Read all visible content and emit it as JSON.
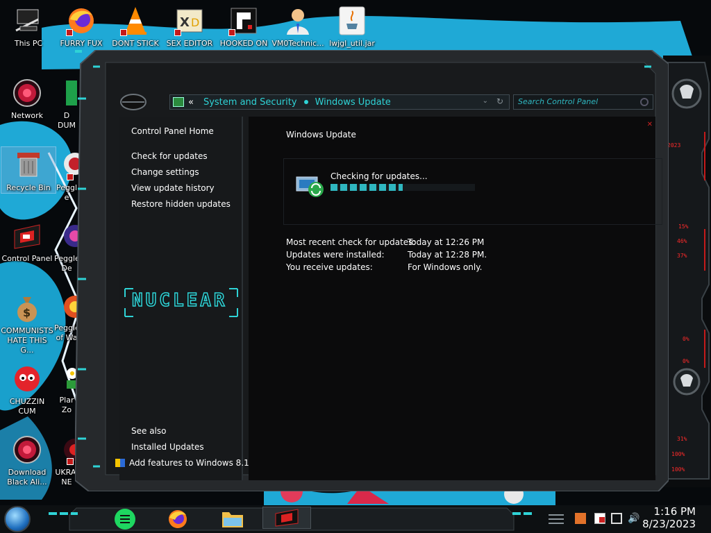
{
  "desktop_icons": [
    {
      "label": "This PC",
      "icon": "computer-icon"
    },
    {
      "label": "FURRY FUX",
      "icon": "firefox-icon"
    },
    {
      "label": "DONT STICK",
      "icon": "vlc-cone-icon"
    },
    {
      "label": "SEX EDITOR",
      "icon": "hex-editor-icon"
    },
    {
      "label": "HOOKED ON",
      "icon": "game-icon"
    },
    {
      "label": "VM0Technic...",
      "icon": "doctor-avatar-icon"
    },
    {
      "label": "lwjgl_util.jar",
      "icon": "java-icon"
    },
    {
      "label": "Network",
      "icon": "alien-orb-icon"
    },
    {
      "label": "D\nDUM",
      "icon": "partial-icon"
    },
    {
      "label": "Recycle Bin",
      "icon": "recycle-bin-icon"
    },
    {
      "label": "Peggle",
      "icon": "peggle-icon"
    },
    {
      "label": "Control Panel",
      "icon": "control-panel-icon"
    },
    {
      "label": "Peggle\nDe",
      "icon": "peggle-icon"
    },
    {
      "label": "COMMUNISTS HATE THIS G...",
      "icon": "money-bag-icon"
    },
    {
      "label": "Peggle\nof Wa",
      "icon": "peggle-icon"
    },
    {
      "label": "CHUZZIN CUM",
      "icon": "chuzzle-icon"
    },
    {
      "label": "Plar\nZo",
      "icon": "plants-icon"
    },
    {
      "label": "Download Black Ali...",
      "icon": "alien-orb-icon"
    },
    {
      "label": "UKRAINE",
      "icon": "ukraine-icon"
    }
  ],
  "window": {
    "breadcrumb": {
      "back_glyph": "«",
      "items": [
        "System and Security",
        "Windows Update"
      ]
    },
    "search": {
      "placeholder": "Search Control Panel"
    },
    "nav": {
      "home": "Control Panel Home",
      "links": [
        "Check for updates",
        "Change settings",
        "View update history",
        "Restore hidden updates"
      ],
      "logo_text": "NUCLEAR",
      "see_also": "See also",
      "see_also_links": [
        "Installed Updates",
        "Add features to Windows 8.1"
      ]
    },
    "content": {
      "title": "Windows Update",
      "status": "Checking for updates...",
      "progress": 0.5,
      "info": [
        {
          "label": "Most recent check for updates:",
          "value": "Today at 12:26 PM"
        },
        {
          "label": "Updates were installed:",
          "value": "Today at 12:28 PM."
        },
        {
          "label": "You receive updates:",
          "value": "For Windows only."
        }
      ]
    }
  },
  "gadget": {
    "readouts": [
      "2023",
      "15%",
      "46%",
      "37%",
      "0%",
      "0%",
      "31%",
      "100%",
      "100%"
    ]
  },
  "taskbar": {
    "apps": [
      "notes-app-icon",
      "firefox-icon",
      "file-explorer-icon",
      "control-panel-icon"
    ],
    "tray": [
      "tray-app-icon",
      "flag-icon",
      "network-icon",
      "volume-icon"
    ],
    "time": "1:16 PM",
    "date": "8/23/2023"
  },
  "colors": {
    "accent_cyan": "#2fd3d6",
    "accent_red": "#c41a1a",
    "window_bg": "#0b0b0c"
  }
}
